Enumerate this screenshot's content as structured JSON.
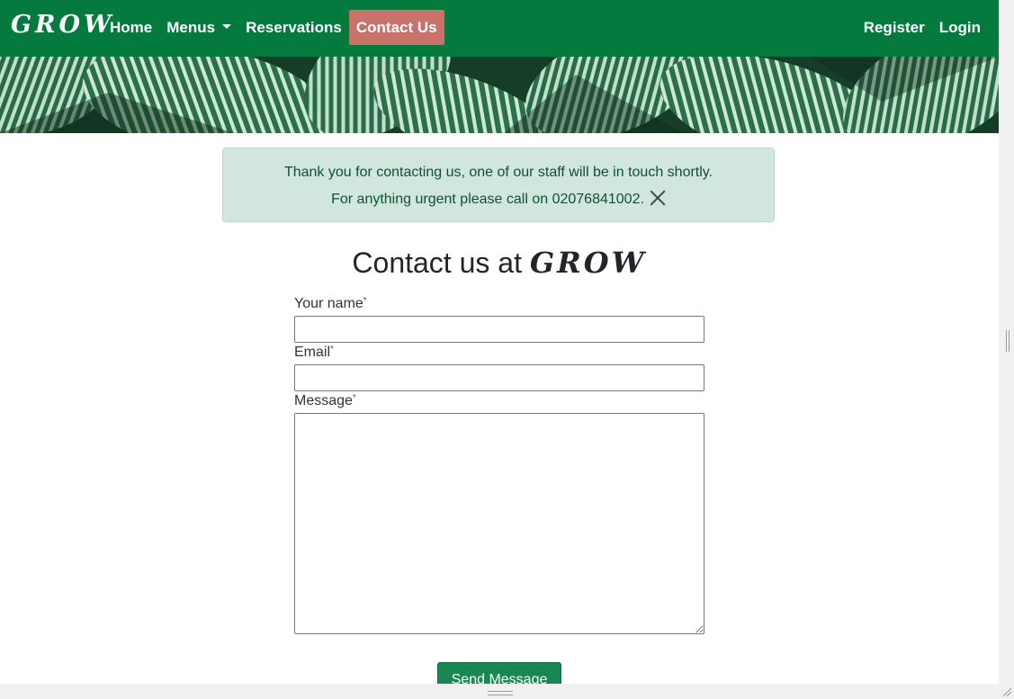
{
  "navbar": {
    "brand": "GROW",
    "links": {
      "home": "Home",
      "menus": "Menus",
      "reservations": "Reservations",
      "contact": "Contact Us"
    },
    "right": {
      "register": "Register",
      "login": "Login"
    },
    "active": "Contact Us"
  },
  "alert": {
    "line1": "Thank you for contacting us, one of our staff will be in touch shortly.",
    "line2": "For anything urgent please call on 02076841002."
  },
  "heading": {
    "prefix": "Contact us at",
    "brand": "GROW"
  },
  "form": {
    "name_label": "Your name",
    "email_label": "Email",
    "message_label": "Message",
    "required_mark": "*",
    "name_value": "",
    "email_value": "",
    "message_value": "",
    "submit_label": "Send Message"
  },
  "colors": {
    "navbar": "#047a3e",
    "active_nav": "#c9726a",
    "alert_bg": "#d1e7dd",
    "button": "#198754"
  },
  "icons": {
    "close": "close-icon",
    "dropdown": "chevron-down-icon"
  }
}
